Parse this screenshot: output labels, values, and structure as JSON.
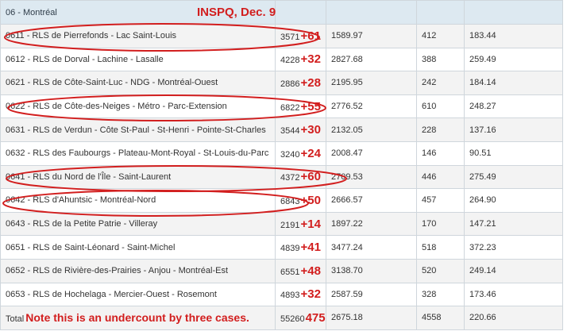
{
  "header": {
    "region": "06 - Montréal",
    "source": "INSPQ, Dec. 9"
  },
  "rows": [
    {
      "name": "0611 - RLS de Pierrefonds - Lac Saint-Louis",
      "cases": "3571",
      "delta": "+61",
      "rate": "1589.97",
      "other": "412",
      "other_rate": "183.44"
    },
    {
      "name": "0612 - RLS de Dorval - Lachine - Lasalle",
      "cases": "4228",
      "delta": "+32",
      "rate": "2827.68",
      "other": "388",
      "other_rate": "259.49"
    },
    {
      "name": "0621 - RLS de Côte-Saint-Luc - NDG - Montréal-Ouest",
      "cases": "2886",
      "delta": "+28",
      "rate": "2195.95",
      "other": "242",
      "other_rate": "184.14"
    },
    {
      "name": "0622 - RLS de Côte-des-Neiges - Métro - Parc-Extension",
      "cases": "6822",
      "delta": "+55",
      "rate": "2776.52",
      "other": "610",
      "other_rate": "248.27"
    },
    {
      "name": "0631 - RLS de Verdun - Côte St-Paul - St-Henri - Pointe-St-Charles",
      "cases": "3544",
      "delta": "+30",
      "rate": "2132.05",
      "other": "228",
      "other_rate": "137.16"
    },
    {
      "name": "0632 - RLS des Faubourgs - Plateau-Mont-Royal - St-Louis-du-Parc",
      "cases": "3240",
      "delta": "+24",
      "rate": "2008.47",
      "other": "146",
      "other_rate": "90.51"
    },
    {
      "name": "0641 - RLS du Nord de l'Île - Saint-Laurent",
      "cases": "4372",
      "delta": "+60",
      "rate": "2709.53",
      "other": "446",
      "other_rate": "275.49"
    },
    {
      "name": "0642 - RLS d'Ahuntsic - Montréal-Nord",
      "cases": "6843",
      "delta": "+50",
      "rate": "2666.57",
      "other": "457",
      "other_rate": "264.90"
    },
    {
      "name": "0643 - RLS de la Petite Patrie - Villeray",
      "cases": "2191",
      "delta": "+14",
      "rate": "1897.22",
      "other": "170",
      "other_rate": "147.21"
    },
    {
      "name": "0651 - RLS de Saint-Léonard - Saint-Michel",
      "cases": "4839",
      "delta": "+41",
      "rate": "3477.24",
      "other": "518",
      "other_rate": "372.23"
    },
    {
      "name": "0652 - RLS de Rivière-des-Prairies - Anjou - Montréal-Est",
      "cases": "6551",
      "delta": "+48",
      "rate": "3138.70",
      "other": "520",
      "other_rate": "249.14"
    },
    {
      "name": "0653 - RLS de Hochelaga - Mercier-Ouest - Rosemont",
      "cases": "4893",
      "delta": "+32",
      "rate": "2587.59",
      "other": "328",
      "other_rate": "173.46"
    }
  ],
  "total": {
    "label": "Total",
    "note": "Note this is an undercount by three cases.",
    "cases": "55260",
    "delta": "475",
    "rate": "2675.18",
    "other": "4558",
    "other_rate": "220.66"
  },
  "colors": {
    "annotation": "#d21e1e",
    "header_bg": "#dde9f1",
    "zebra_bg": "#f3f3f3",
    "border": "#cfd6dc"
  }
}
